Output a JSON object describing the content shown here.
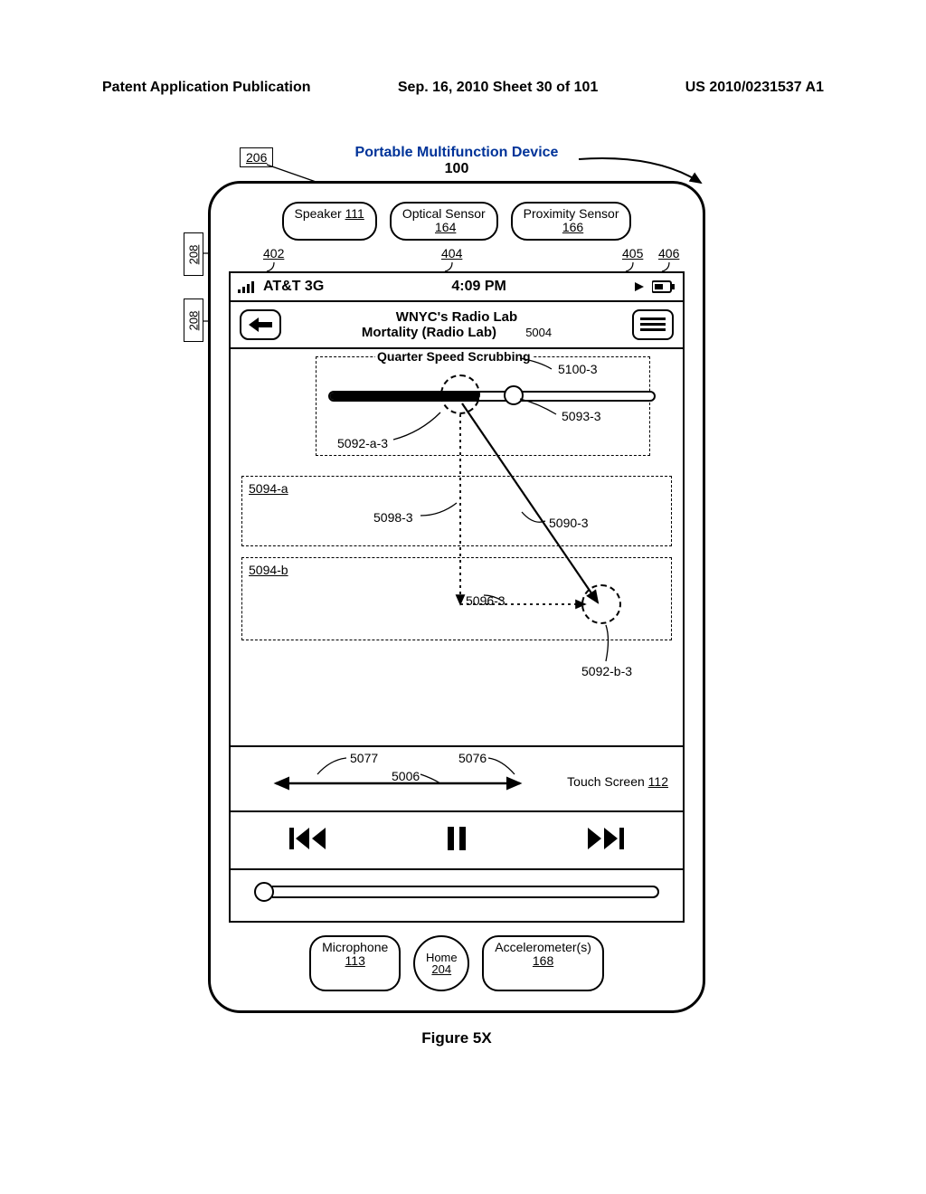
{
  "header": {
    "left": "Patent Application Publication",
    "center": "Sep. 16, 2010  Sheet 30 of 101",
    "right": "US 2010/0231537 A1"
  },
  "device": {
    "title": "Portable Multifunction Device",
    "ref": "100",
    "box_206": "206",
    "side_208": "208",
    "sensors": {
      "speaker": {
        "label": "Speaker",
        "ref": "111"
      },
      "optical": {
        "label": "Optical Sensor",
        "ref": "164"
      },
      "proximity": {
        "label": "Proximity Sensor",
        "ref": "166"
      }
    },
    "callouts": {
      "c402": "402",
      "c404": "404",
      "c405": "405",
      "c406": "406"
    },
    "status": {
      "carrier": "AT&T 3G",
      "time": "4:09 PM"
    },
    "title_mid": {
      "line1": "WNYC's Radio Lab",
      "line2": "Mortality (Radio Lab)",
      "ref": "5004"
    },
    "scrub": {
      "mode_label": "Quarter Speed Scrubbing",
      "r5100_3": "5100-3",
      "r5093_3": "5093-3",
      "r5092_a_3": "5092-a-3",
      "r5094_a": "5094-a",
      "r5098_3": "5098-3",
      "r5090_3": "5090-3",
      "r5094_b": "5094-b",
      "r5096_3": "5096-3",
      "r5092_b_3": "5092-b-3"
    },
    "below": {
      "r5077": "5077",
      "r5076": "5076",
      "r5006": "5006",
      "touch_screen": "Touch Screen",
      "ts_ref": "112"
    },
    "hw": {
      "mic": {
        "label": "Microphone",
        "ref": "113"
      },
      "home": {
        "label": "Home",
        "ref": "204"
      },
      "accel": {
        "label": "Accelerometer(s)",
        "ref": "168"
      }
    }
  },
  "figure_caption": "Figure 5X"
}
